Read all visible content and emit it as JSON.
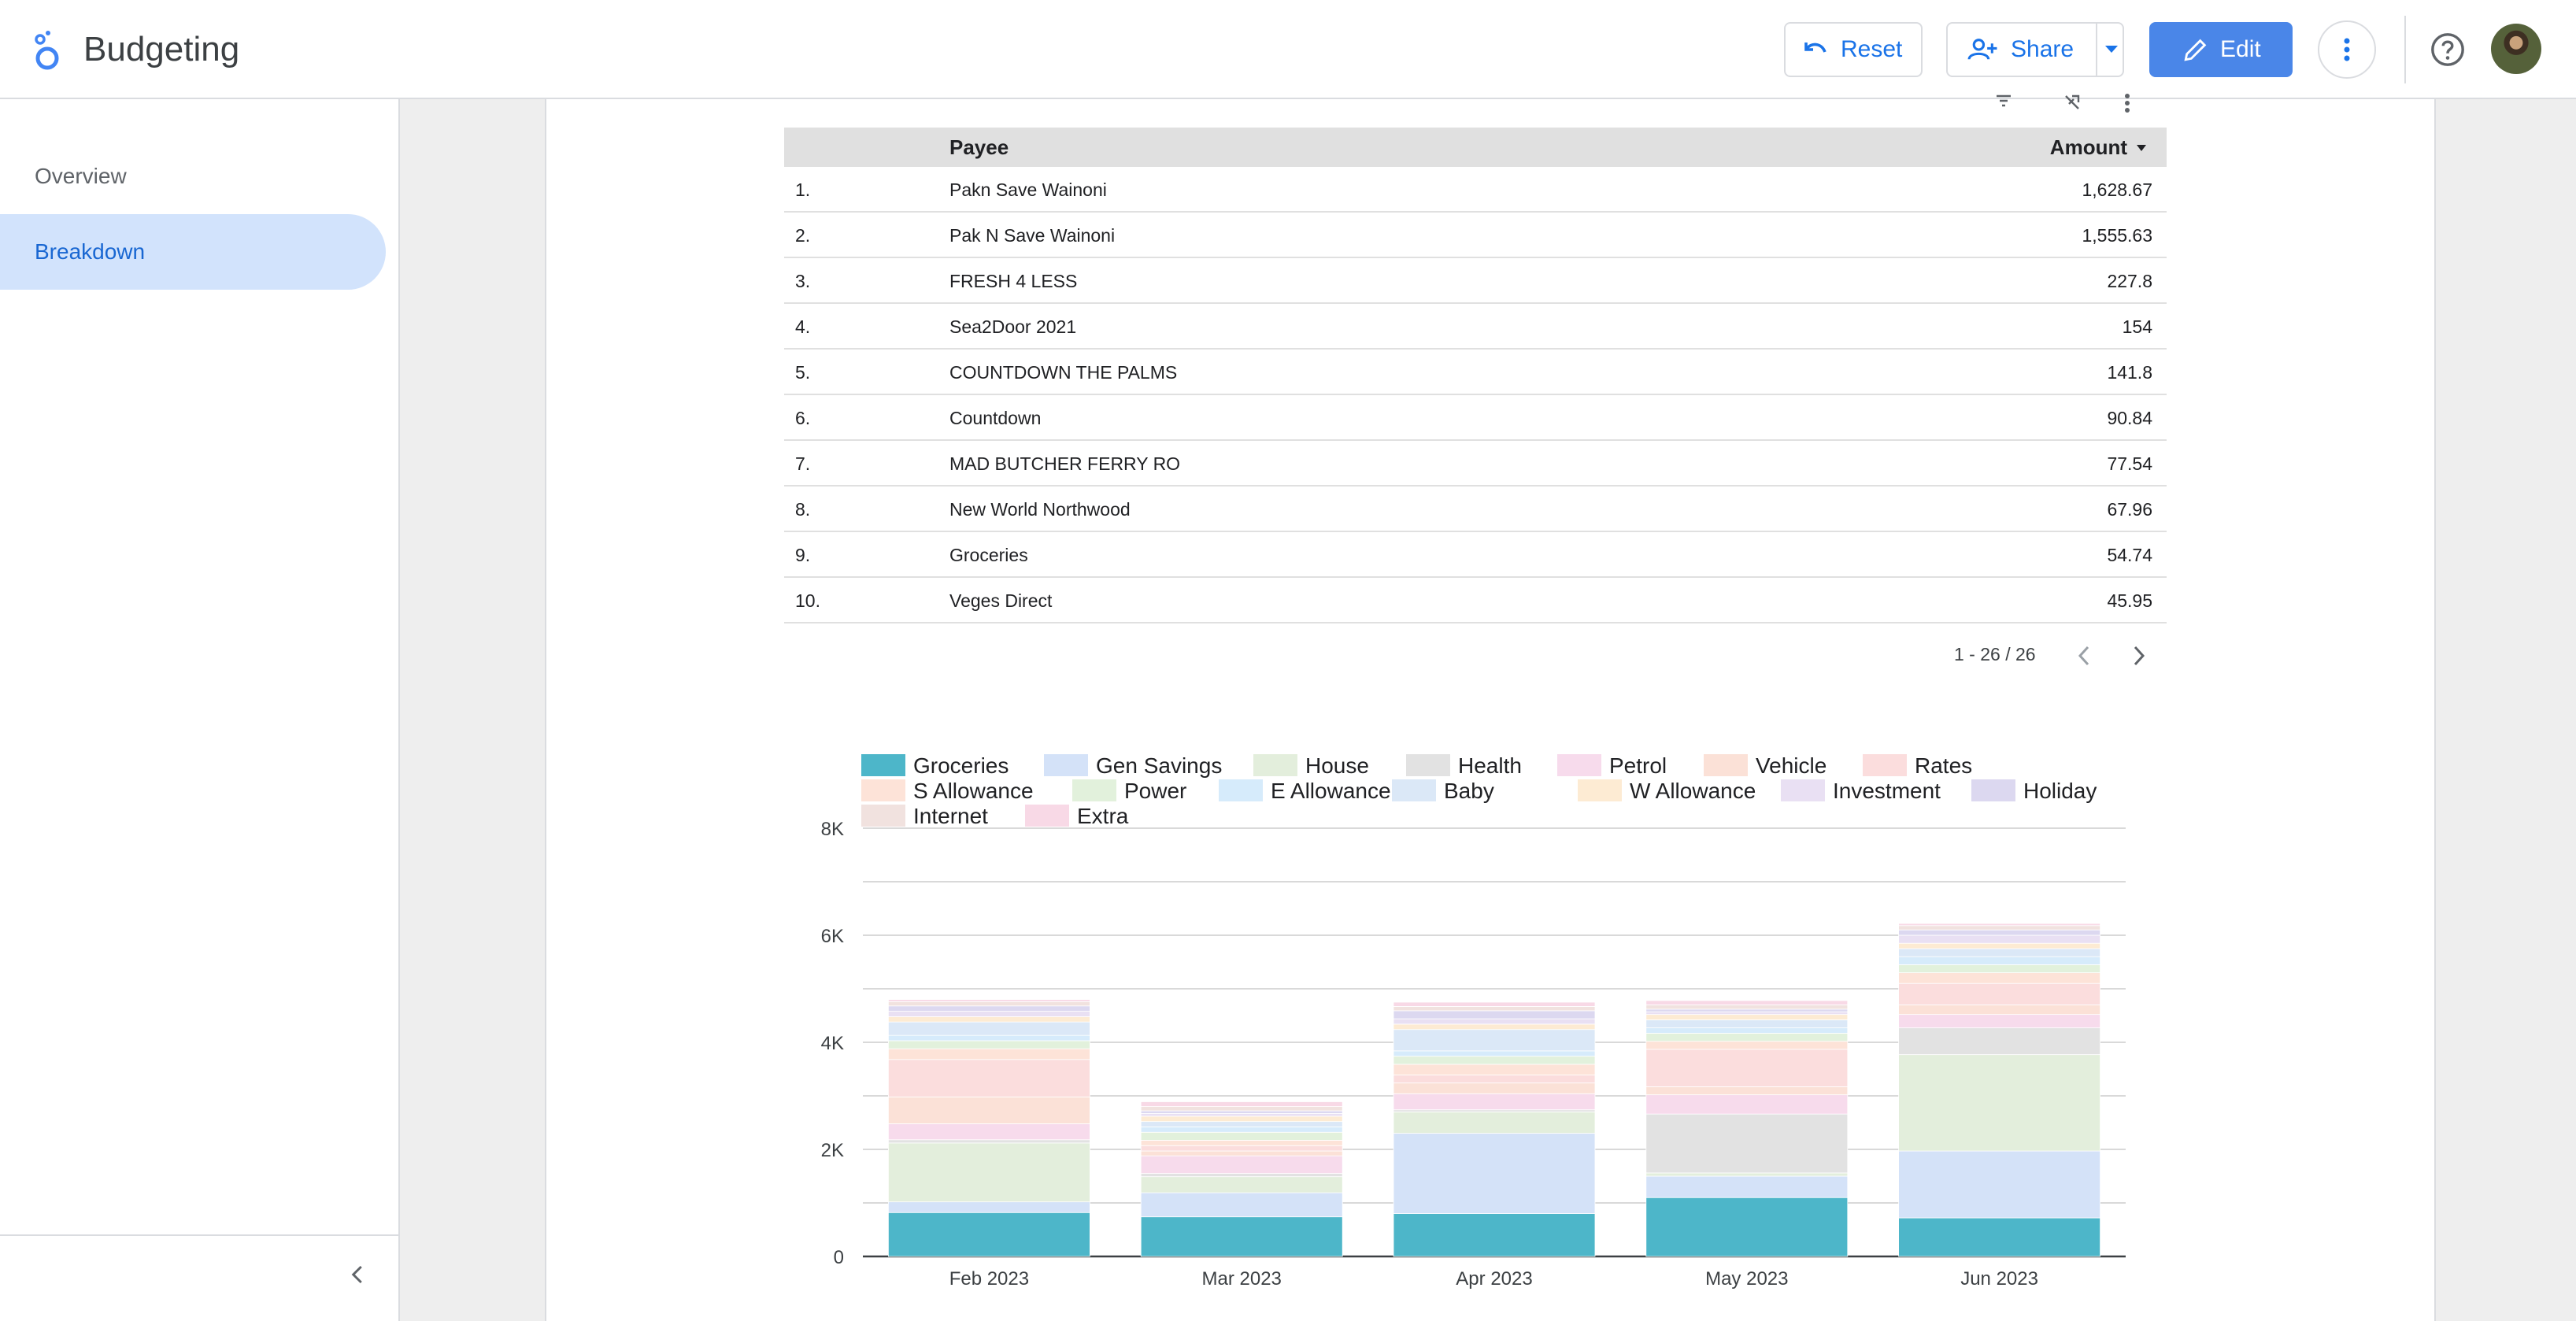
{
  "header": {
    "title": "Budgeting",
    "reset_label": "Reset",
    "share_label": "Share",
    "edit_label": "Edit"
  },
  "sidebar": {
    "items": [
      {
        "label": "Overview",
        "active": false
      },
      {
        "label": "Breakdown",
        "active": true
      }
    ]
  },
  "table": {
    "columns": [
      "Payee",
      "Amount"
    ],
    "rows": [
      {
        "num": "1.",
        "payee": "Pakn Save Wainoni",
        "amount": "1,628.67"
      },
      {
        "num": "2.",
        "payee": "Pak N Save Wainoni",
        "amount": "1,555.63"
      },
      {
        "num": "3.",
        "payee": "FRESH 4 LESS",
        "amount": "227.8"
      },
      {
        "num": "4.",
        "payee": "Sea2Door 2021",
        "amount": "154"
      },
      {
        "num": "5.",
        "payee": "COUNTDOWN THE PALMS",
        "amount": "141.8"
      },
      {
        "num": "6.",
        "payee": "Countdown",
        "amount": "90.84"
      },
      {
        "num": "7.",
        "payee": "MAD BUTCHER FERRY RO",
        "amount": "77.54"
      },
      {
        "num": "8.",
        "payee": "New World Northwood",
        "amount": "67.96"
      },
      {
        "num": "9.",
        "payee": "Groceries",
        "amount": "54.74"
      },
      {
        "num": "10.",
        "payee": "Veges Direct",
        "amount": "45.95"
      }
    ],
    "pagination": "1 - 26 / 26"
  },
  "colors": {
    "accent": "#1a73e8",
    "edit_button": "#4a86e8",
    "nav_active_bg": "#d2e3fc"
  },
  "chart_data": {
    "type": "bar",
    "stacked": true,
    "categories": [
      "Feb 2023",
      "Mar 2023",
      "Apr 2023",
      "May 2023",
      "Jun 2023"
    ],
    "ylim": [
      0,
      8000
    ],
    "yticks": [
      0,
      2000,
      4000,
      6000,
      8000
    ],
    "ytick_labels": [
      "0",
      "2K",
      "4K",
      "6K",
      "8K"
    ],
    "grid": true,
    "legend_position": "top",
    "series": [
      {
        "name": "Groceries",
        "color": "#4db6c9",
        "values": [
          820,
          740,
          800,
          1100,
          720
        ]
      },
      {
        "name": "Gen Savings",
        "color": "#d4e2f8",
        "values": [
          200,
          450,
          1500,
          400,
          1250
        ]
      },
      {
        "name": "House",
        "color": "#e3eedc",
        "values": [
          1100,
          300,
          400,
          60,
          1800
        ]
      },
      {
        "name": "Health",
        "color": "#e2e2e2",
        "values": [
          60,
          60,
          40,
          1100,
          500
        ]
      },
      {
        "name": "Petrol",
        "color": "#f7dbec",
        "values": [
          300,
          330,
          300,
          360,
          250
        ]
      },
      {
        "name": "Vehicle",
        "color": "#fbe1d7",
        "values": [
          500,
          90,
          200,
          150,
          180
        ]
      },
      {
        "name": "Rates",
        "color": "#fbdddd",
        "values": [
          700,
          100,
          150,
          700,
          400
        ]
      },
      {
        "name": "S Allowance",
        "color": "#fde3d8",
        "values": [
          200,
          100,
          200,
          150,
          200
        ]
      },
      {
        "name": "Power",
        "color": "#e2f1dc",
        "values": [
          150,
          150,
          150,
          150,
          150
        ]
      },
      {
        "name": "E Allowance",
        "color": "#d6ebfb",
        "values": [
          100,
          100,
          100,
          100,
          150
        ]
      },
      {
        "name": "Baby",
        "color": "#dbe8f7",
        "values": [
          250,
          100,
          400,
          150,
          150
        ]
      },
      {
        "name": "W Allowance",
        "color": "#fdebd3",
        "values": [
          100,
          100,
          100,
          100,
          100
        ]
      },
      {
        "name": "Investment",
        "color": "#e9e0f3",
        "values": [
          100,
          50,
          100,
          50,
          150
        ]
      },
      {
        "name": "Holiday",
        "color": "#dcd8f0",
        "values": [
          100,
          50,
          150,
          50,
          100
        ]
      },
      {
        "name": "Internet",
        "color": "#f1e2df",
        "values": [
          80,
          80,
          80,
          80,
          80
        ]
      },
      {
        "name": "Extra",
        "color": "#f8d9e6",
        "values": [
          40,
          90,
          80,
          80,
          40
        ]
      }
    ]
  }
}
